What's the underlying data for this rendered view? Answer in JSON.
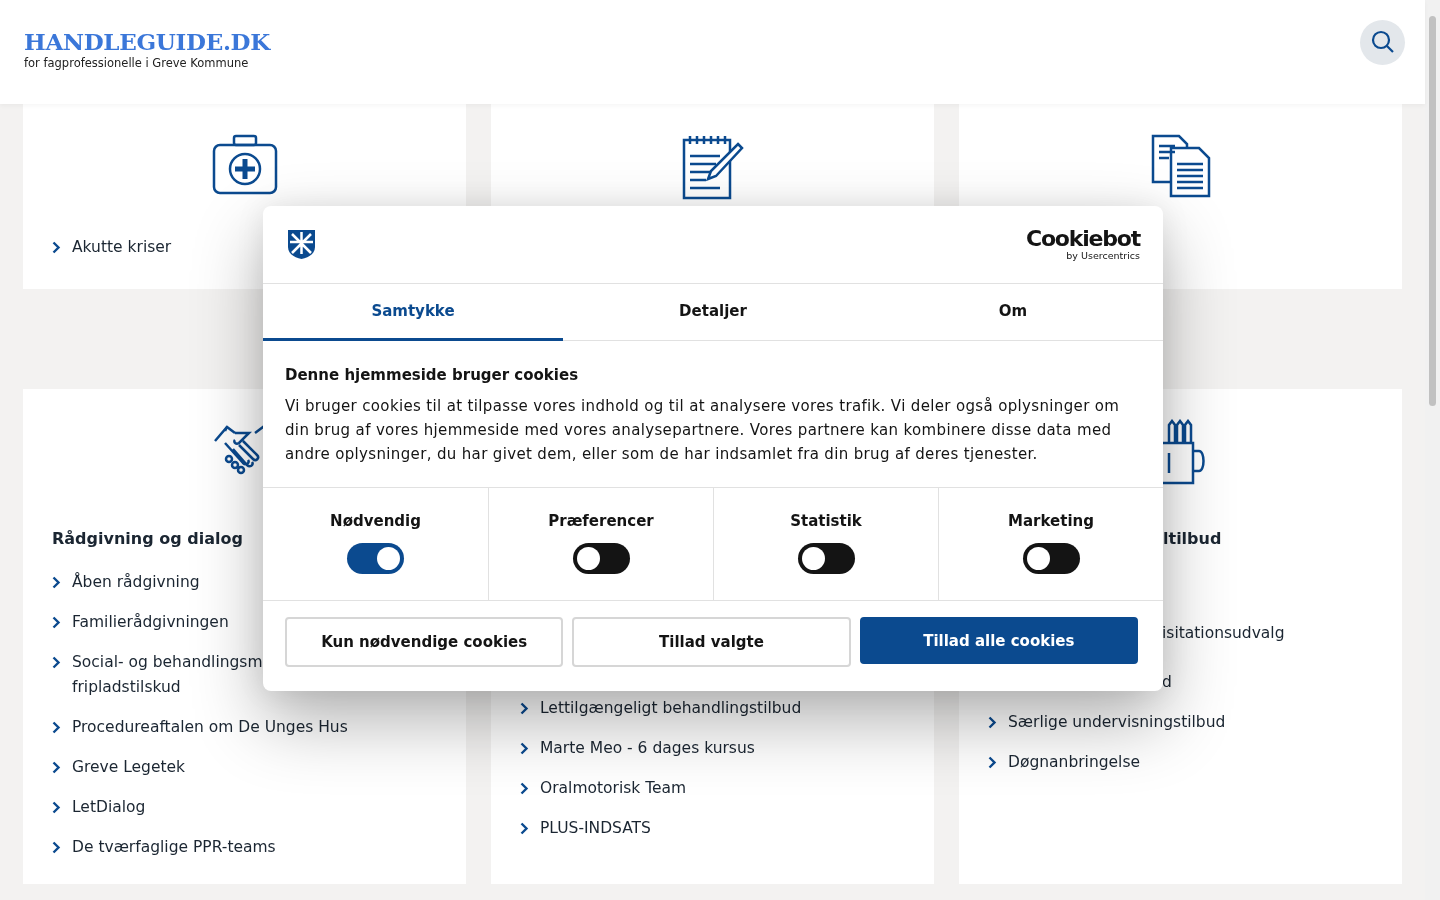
{
  "header": {
    "logo": "HANDLEGUIDE.DK",
    "tagline": "for fagprofessionelle i Greve Kommune"
  },
  "top_cards": [
    {
      "kind": "first-aid-kit",
      "links": [
        "Akutte kriser"
      ]
    },
    {
      "kind": "notepad"
    },
    {
      "kind": "documents"
    }
  ],
  "cards": [
    {
      "kind": "handshake",
      "heading": {
        "text": "Rådgivning og dialog",
        "kind": "full"
      },
      "links": [
        {
          "kind": "link",
          "lines": [
            "Åben rådgivning"
          ]
        },
        {
          "kind": "link",
          "lines": [
            "Familierådgivningen"
          ]
        },
        {
          "kind": "link",
          "lines": [
            "Social- og behandlingsm",
            "fripladstilskud"
          ]
        },
        {
          "kind": "link",
          "lines": [
            "Procedureaftalen om De Unges Hus"
          ]
        },
        {
          "kind": "link",
          "lines": [
            "Greve Legetek"
          ]
        },
        {
          "kind": "link",
          "lines": [
            "LetDialog"
          ]
        },
        {
          "kind": "link",
          "lines": [
            "De tværfaglige PPR-teams"
          ]
        }
      ]
    },
    {
      "kind": "none",
      "links": [
        {
          "kind": "link",
          "lines": [
            "Lettilgængeligt behandlingstilbud"
          ]
        },
        {
          "kind": "link",
          "lines": [
            "Marte Meo - 6 dages kursus"
          ]
        },
        {
          "kind": "link",
          "lines": [
            "Oralmotorisk Team"
          ]
        },
        {
          "kind": "link",
          "lines": [
            "PLUS-INDSATS"
          ]
        }
      ]
    },
    {
      "kind": "mug",
      "heading": {
        "text": "ltilbud",
        "kind": "cut"
      },
      "links": [
        {
          "kind": "cut",
          "lines": [
            "isitationsudvalg"
          ]
        },
        {
          "kind": "cut",
          "lines": [
            "d"
          ]
        },
        {
          "kind": "link",
          "lines": [
            "Særlige undervisningstilbud"
          ]
        },
        {
          "kind": "link",
          "lines": [
            "Døgnanbringelse"
          ]
        }
      ]
    }
  ],
  "consent": {
    "brand": "Cookiebot",
    "brand_sub": "by Usercentrics",
    "tabs": [
      {
        "label": "Samtykke",
        "selected": true
      },
      {
        "label": "Detaljer",
        "selected": false
      },
      {
        "label": "Om",
        "selected": false
      }
    ],
    "title": "Denne hjemmeside bruger cookies",
    "text": "Vi bruger cookies til at tilpasse vores indhold og til at analysere vores trafik. Vi deler også oplysninger om din brug af vores hjemmeside med vores analysepartnere. Vores partnere kan kombinere disse data med andre oplysninger, du har givet dem, eller som de har indsamlet fra din brug af deres tjenester.",
    "categories": [
      {
        "label": "Nødvendig",
        "checked": true
      },
      {
        "label": "Præferencer",
        "checked": false
      },
      {
        "label": "Statistik",
        "checked": false
      },
      {
        "label": "Marketing",
        "checked": false
      }
    ],
    "buttons": [
      {
        "label": "Kun nødvendige cookies",
        "kind": "outline"
      },
      {
        "label": "Tillad valgte",
        "kind": "outline"
      },
      {
        "label": "Tillad alle cookies",
        "kind": "primary"
      }
    ]
  }
}
